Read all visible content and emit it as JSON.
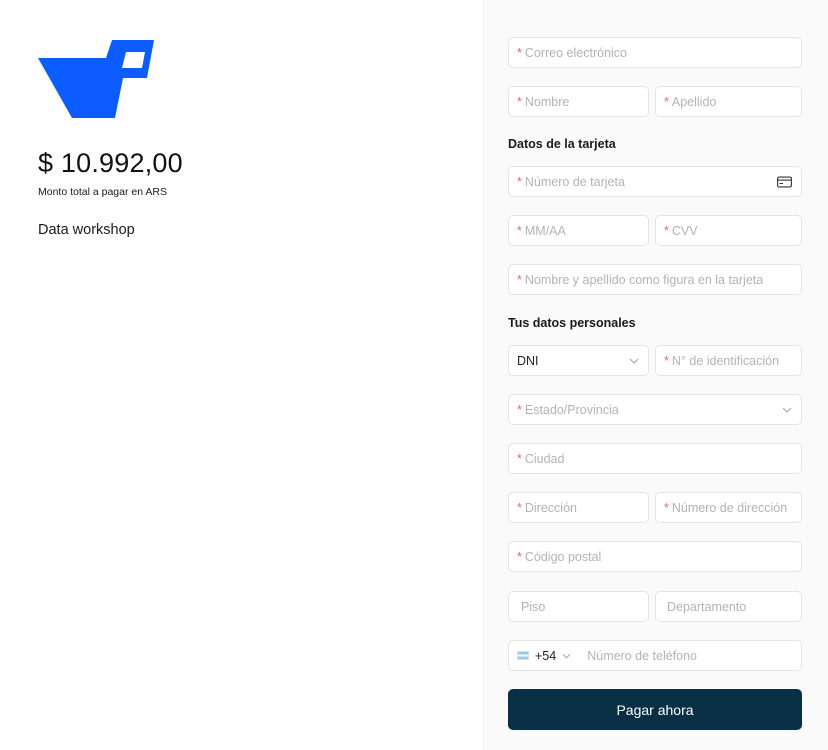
{
  "merchant": {
    "logo_icon": "brand-logo-icon",
    "brand_color": "#0d5cff"
  },
  "summary": {
    "amount": "$ 10.992,00",
    "amount_caption": "Monto total a pagar en ARS",
    "product": "Data workshop"
  },
  "form": {
    "required_mark": "*",
    "email_placeholder": "Correo electrónico",
    "first_name_placeholder": "Nombre",
    "last_name_placeholder": "Apellido",
    "card_section_title": "Datos de la tarjeta",
    "card_number_placeholder": "Número de tarjeta",
    "expiry_placeholder": "MM/AA",
    "cvv_placeholder": "CVV",
    "cardholder_placeholder": "Nombre y apellido como figura en la tarjeta",
    "personal_section_title": "Tus datos personales",
    "id_type_value": "DNI",
    "id_number_placeholder": "N° de identificación",
    "state_placeholder": "Estado/Provincia",
    "city_placeholder": "Ciudad",
    "address_placeholder": "Dirección",
    "address_number_placeholder": "Número de dirección",
    "postal_code_placeholder": "Código postal",
    "floor_placeholder": "Piso",
    "apartment_placeholder": "Departamento",
    "phone_prefix": "+54",
    "phone_placeholder": "Número de teléfono",
    "submit_label": "Pagar ahora"
  },
  "colors": {
    "button_bg": "#082f45",
    "required": "#e06c6c"
  }
}
